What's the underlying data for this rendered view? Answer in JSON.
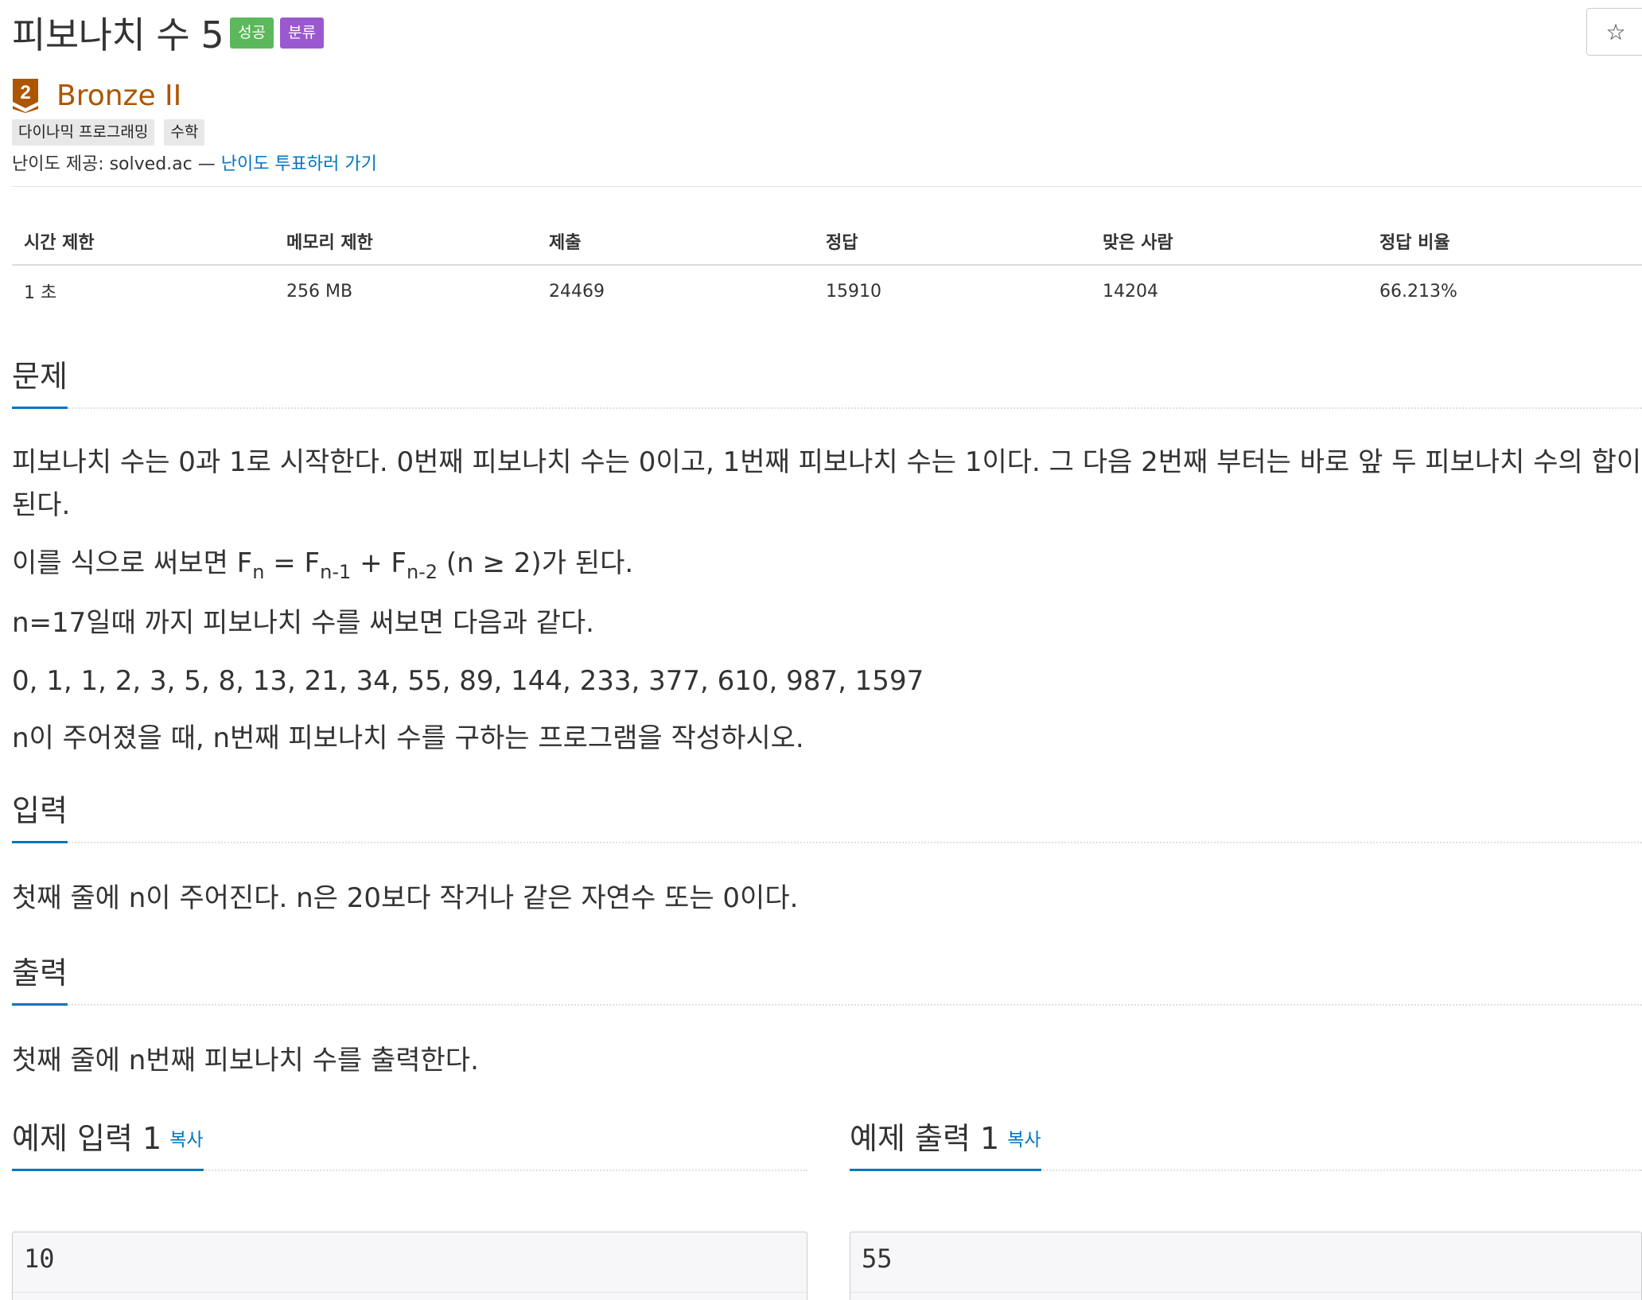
{
  "header": {
    "title": "피보나치 수 5",
    "badge_success": "성공",
    "badge_category": "분류",
    "star_icon": "☆",
    "tier_number": "2",
    "tier_name": "Bronze II",
    "tags": [
      "다이나믹 프로그래밍",
      "수학"
    ],
    "provider_text": "난이도 제공: solved.ac — ",
    "vote_link": "난이도 투표하러 가기"
  },
  "colors": {
    "success": "#5cb85c",
    "category": "#9b59d0",
    "tier": "#ad5600",
    "link": "#0076c0"
  },
  "info": {
    "headers": [
      "시간 제한",
      "메모리 제한",
      "제출",
      "정답",
      "맞은 사람",
      "정답 비율"
    ],
    "values": [
      "1 초",
      "256 MB",
      "24469",
      "15910",
      "14204",
      "66.213%"
    ]
  },
  "problem": {
    "title": "문제",
    "p1": "피보나치 수는 0과 1로 시작한다. 0번째 피보나치 수는 0이고, 1번째 피보나치 수는 1이다. 그 다음 2번째 부터는 바로 앞 두 피보나치 수의 합이 된다.",
    "p2_prefix": "이를 식으로 써보면 F",
    "p2_sub1": "n",
    "p2_mid1": " = F",
    "p2_sub2": "n-1",
    "p2_mid2": " + F",
    "p2_sub3": "n-2",
    "p2_suffix": " (n ≥ 2)가 된다.",
    "p3": "n=17일때 까지 피보나치 수를 써보면 다음과 같다.",
    "p4": "0, 1, 1, 2, 3, 5, 8, 13, 21, 34, 55, 89, 144, 233, 377, 610, 987, 1597",
    "p5": "n이 주어졌을 때, n번째 피보나치 수를 구하는 프로그램을 작성하시오."
  },
  "input_section": {
    "title": "입력",
    "text": "첫째 줄에 n이 주어진다. n은 20보다 작거나 같은 자연수 또는 0이다."
  },
  "output_section": {
    "title": "출력",
    "text": "첫째 줄에 n번째 피보나치 수를 출력한다."
  },
  "samples": {
    "input_title": "예제 입력 1",
    "output_title": "예제 출력 1",
    "copy_label": "복사",
    "input_value": "10",
    "output_value": "55"
  }
}
